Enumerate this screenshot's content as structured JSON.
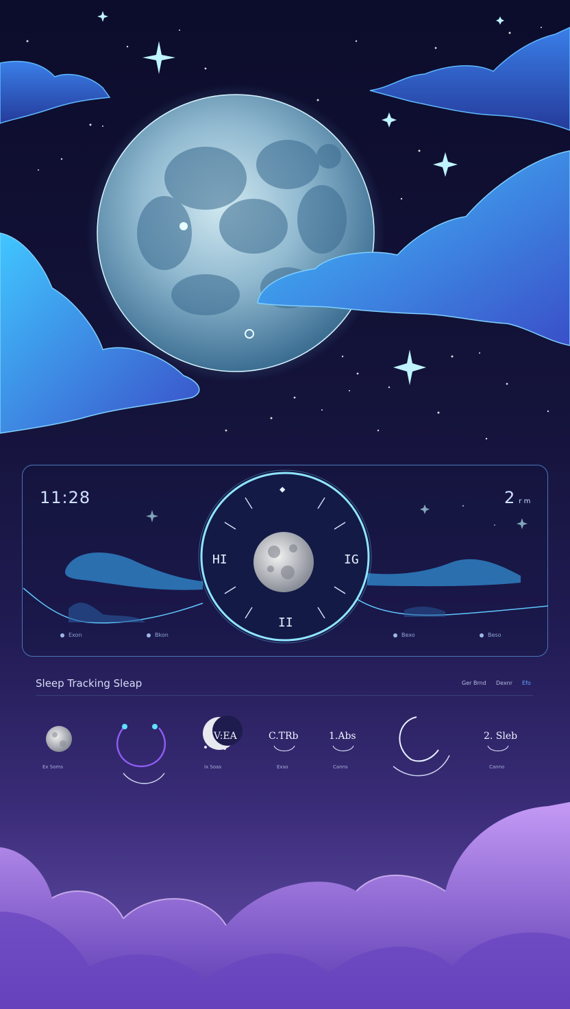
{
  "clock": {
    "time_left": "11:28",
    "time_right": "2",
    "time_right_suffix": "r  m",
    "dial_labels": {
      "top": "◆",
      "left": "HI",
      "right": "IG",
      "bottom": "II"
    }
  },
  "legend": [
    {
      "label": "Exon"
    },
    {
      "label": "Bkon"
    },
    {
      "label": "Bexo"
    },
    {
      "label": "Beso"
    }
  ],
  "section": {
    "title": "Sleep Tracking Sleap",
    "tabs": [
      "Ger Brnd",
      "Dexnr",
      "Efo"
    ]
  },
  "stats": [
    {
      "value": "",
      "label": "Ex Soms"
    },
    {
      "value": "",
      "label": ""
    },
    {
      "value": "V:EA",
      "label": "Ix Soas"
    },
    {
      "value": "C.TRb",
      "label": "Exso"
    },
    {
      "value": "1.Abs",
      "label": "Canns"
    },
    {
      "value": "",
      "label": ""
    },
    {
      "value": "2. Sleb",
      "label": "Canno"
    }
  ],
  "colors": {
    "accent": "#5fa6ff",
    "panel_border": "#4a78b8",
    "glow": "#6ee0ff",
    "cloud_purple": "#9b6fe6"
  }
}
